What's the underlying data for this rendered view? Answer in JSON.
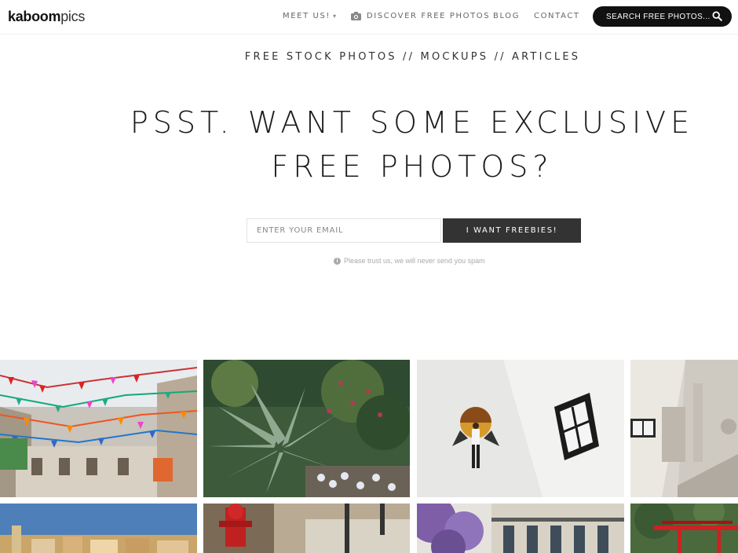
{
  "header": {
    "logo_bold": "kaboom",
    "logo_light": "pics",
    "nav": {
      "meet_us": "MEET US!",
      "discover": "DISCOVER FREE PHOTOS",
      "blog": "BLOG",
      "contact": "CONTACT"
    },
    "search_label": "SEARCH FREE PHOTOS..."
  },
  "hero": {
    "tagline": "FREE STOCK PHOTOS // MOCKUPS // ARTICLES",
    "headline": "PSST. WANT SOME EXCLUSIVE FREE PHOTOS?",
    "email_placeholder": "ENTER YOUR EMAIL",
    "cta_label": "I WANT FREEBIES!",
    "spam_note": "Please trust us, we will never send you spam"
  },
  "icons": {
    "meet_us_caret": "chevron-down-icon",
    "discover": "camera-icon",
    "search": "search-icon",
    "spam_note": "info-icon"
  },
  "colors": {
    "search_button_bg": "#111111",
    "cta_button_bg": "#333333",
    "nav_text": "#666666"
  },
  "photos": [
    {
      "subject": "street-bunting"
    },
    {
      "subject": "agave-plant"
    },
    {
      "subject": "white-wall-mural-window"
    },
    {
      "subject": "baroque-building-facade"
    },
    {
      "subject": "coastal-town"
    },
    {
      "subject": "red-fire-hydrant"
    },
    {
      "subject": "jacaranda-building"
    },
    {
      "subject": "red-pergola"
    }
  ]
}
